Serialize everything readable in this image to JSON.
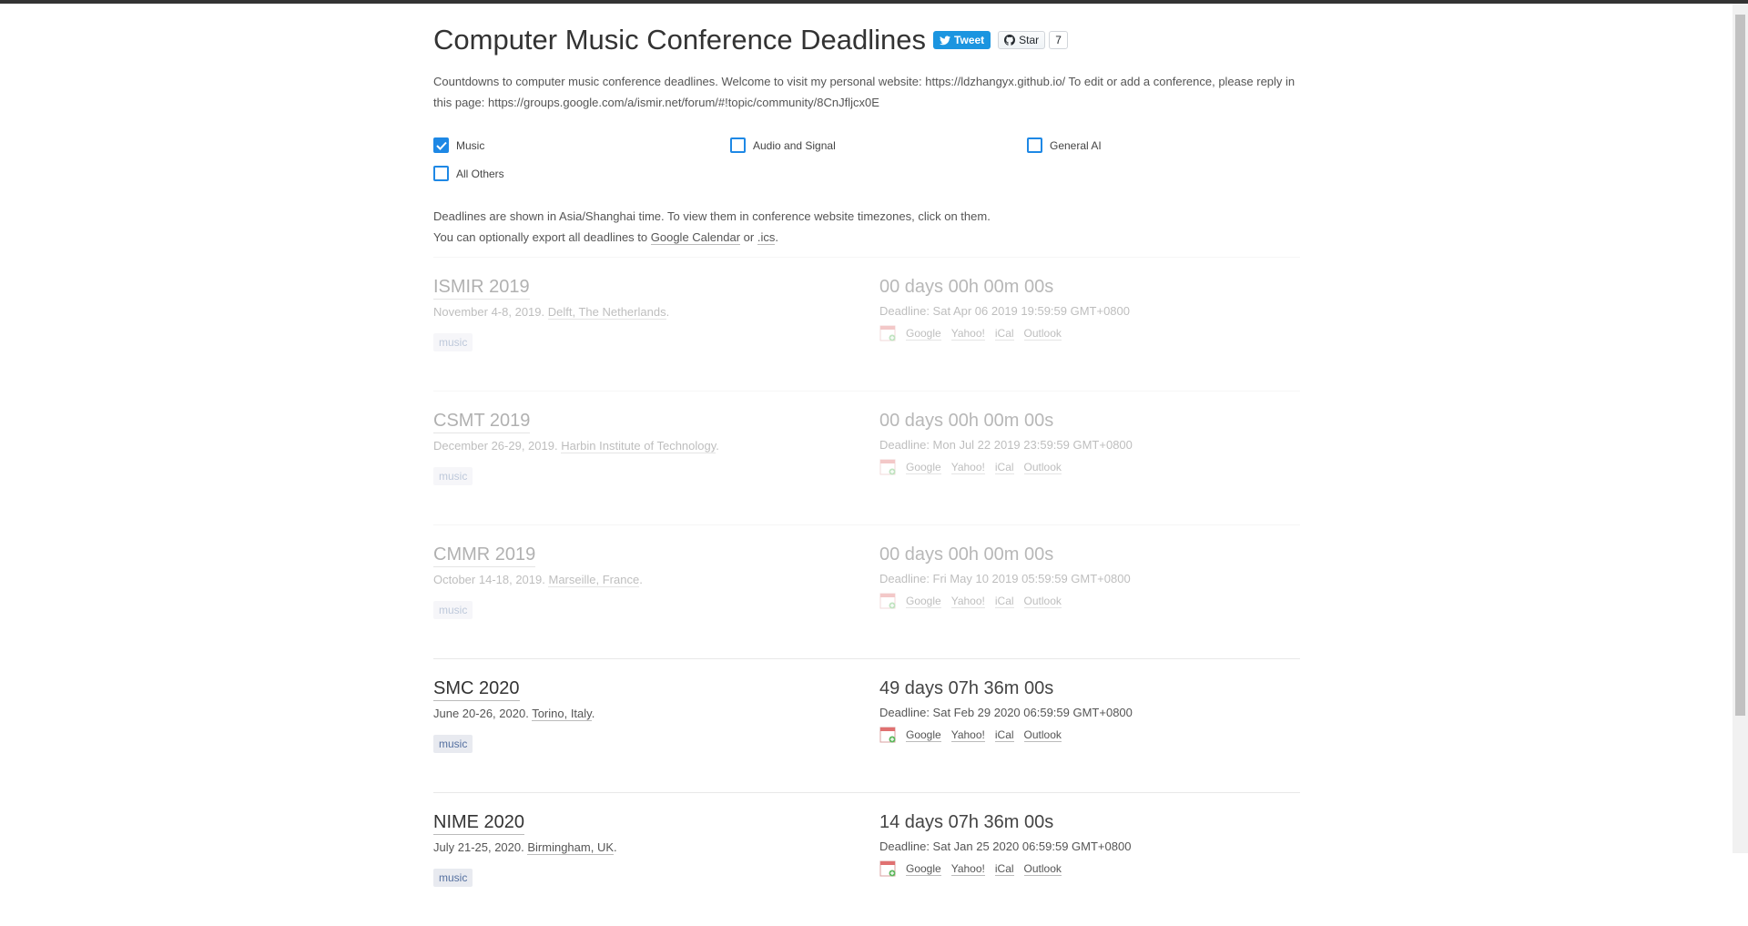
{
  "header": {
    "title": "Computer Music Conference Deadlines",
    "tweet_label": "Tweet",
    "star_label": "Star",
    "star_count": "7"
  },
  "intro": {
    "line1": "Countdowns to computer music conference deadlines. Welcome to visit my personal website: https://ldzhangyx.github.io/ To edit or add a conference, please reply in",
    "line2": "this page: https://groups.google.com/a/ismir.net/forum/#!topic/community/8CnJfljcx0E"
  },
  "filters": [
    {
      "label": "Music",
      "checked": true
    },
    {
      "label": "Audio and Signal",
      "checked": false
    },
    {
      "label": "General AI",
      "checked": false
    },
    {
      "label": "All Others",
      "checked": false
    }
  ],
  "note": {
    "line1": "Deadlines are shown in Asia/Shanghai time. To view them in conference website timezones, click on them.",
    "line2_prefix": "You can optionally export all deadlines to ",
    "google_calendar": "Google Calendar",
    "or": " or ",
    "ics": ".ics",
    "end": "."
  },
  "calendar_links": {
    "google": "Google",
    "yahoo": "Yahoo!",
    "ical": "iCal",
    "outlook": "Outlook"
  },
  "conferences": [
    {
      "name": "ISMIR 2019",
      "dates": "November 4-8, 2019. ",
      "place": "Delft, The Netherlands",
      "tag": "music",
      "countdown": "00 days 00h 00m 00s",
      "deadline": "Deadline: Sat Apr 06 2019 19:59:59 GMT+0800",
      "past": true
    },
    {
      "name": "CSMT 2019",
      "dates": "December 26-29, 2019. ",
      "place": "Harbin Institute of Technology",
      "tag": "music",
      "countdown": "00 days 00h 00m 00s",
      "deadline": "Deadline: Mon Jul 22 2019 23:59:59 GMT+0800",
      "past": true
    },
    {
      "name": "CMMR 2019",
      "dates": "October 14-18, 2019. ",
      "place": "Marseille, France",
      "tag": "music",
      "countdown": "00 days 00h 00m 00s",
      "deadline": "Deadline: Fri May 10 2019 05:59:59 GMT+0800",
      "past": true
    },
    {
      "name": "SMC 2020",
      "dates": "June 20-26, 2020. ",
      "place": "Torino, Italy",
      "tag": "music",
      "countdown": "49 days 07h 36m 00s",
      "deadline": "Deadline: Sat Feb 29 2020 06:59:59 GMT+0800",
      "past": false
    },
    {
      "name": "NIME 2020",
      "dates": "July 21-25, 2020. ",
      "place": "Birmingham, UK",
      "tag": "music",
      "countdown": "14 days 07h 36m 00s",
      "deadline": "Deadline: Sat Jan 25 2020 06:59:59 GMT+0800",
      "past": false
    }
  ]
}
